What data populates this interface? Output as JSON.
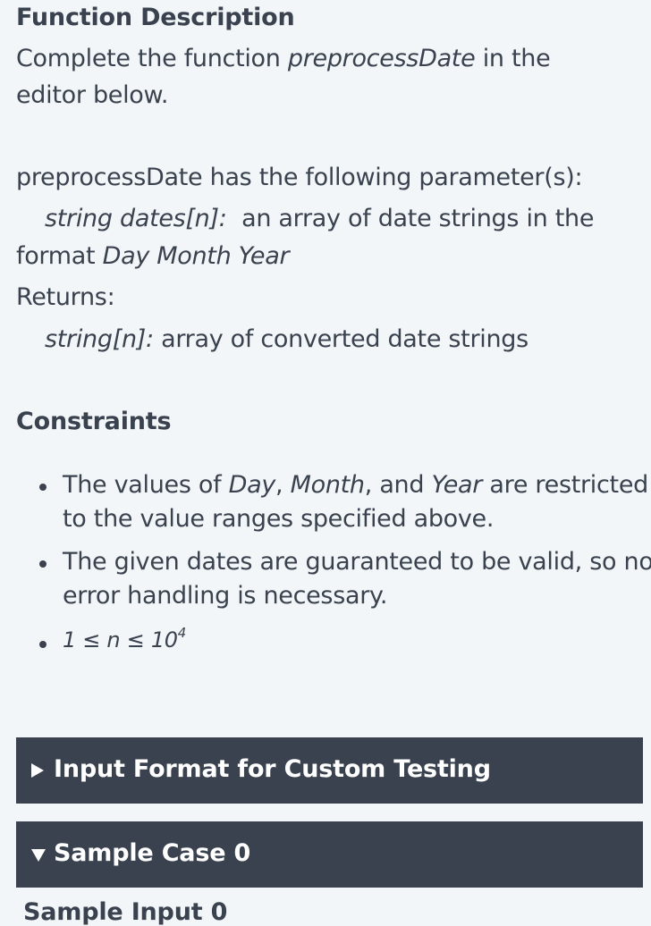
{
  "function_description": {
    "heading": "Function Description",
    "line1_prefix": "Complete the function ",
    "function_name": "preprocessDate",
    "line1_suffix": " in the",
    "line2": "editor below."
  },
  "parameters": {
    "intro": "preprocessDate has the following parameter(s):",
    "param_type": "string dates[n]:",
    "param_desc": "an array of date strings in the",
    "param_desc2_prefix": "format ",
    "param_format": "Day Month Year",
    "returns_label": "Returns:",
    "return_type": "string[n]:",
    "return_desc": " array of converted date strings"
  },
  "constraints": {
    "heading": "Constraints",
    "item1": {
      "prefix": "The values of ",
      "day": "Day",
      "comma1": ", ",
      "month": "Month",
      "mid": ", and ",
      "year": "Year",
      "suffix": " are restricted",
      "line2": "to the value ranges specified above."
    },
    "item2": {
      "line1": "The given dates are guaranteed to be valid, so no",
      "line2": "error handling is necessary."
    },
    "item3": {
      "base": "1 ≤ n ≤ 10",
      "exponent": "4"
    }
  },
  "sections": {
    "input_format_label": "Input Format for Custom Testing",
    "sample_case_label": "Sample Case 0",
    "sample_input_label": "Sample Input 0"
  }
}
